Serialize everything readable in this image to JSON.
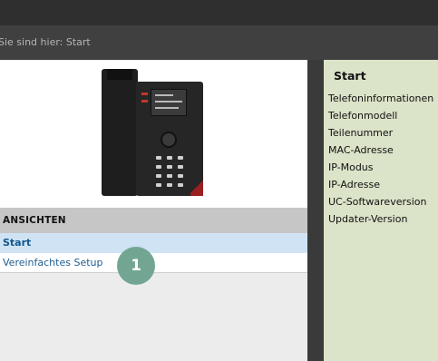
{
  "breadcrumb": {
    "text": "Sie sind hier: Start"
  },
  "views": {
    "header": "ANSICHTEN",
    "items": [
      {
        "label": "Start",
        "selected": true
      },
      {
        "label": "Vereinfachtes Setup",
        "selected": false
      }
    ]
  },
  "annotation": {
    "badge": "1"
  },
  "info_panel": {
    "title": "Start",
    "items": [
      "Telefoninformationen",
      "Telefonmodell",
      "Teilenummer",
      "MAC-Adresse",
      "IP-Modus",
      "IP-Adresse",
      "UC-Softwareversion",
      "Updater-Version"
    ]
  },
  "colors": {
    "selected_item_bg": "#cfe3f5",
    "link": "#1f5c8e",
    "info_panel_bg": "#dbe3c8",
    "badge": "#72a693"
  },
  "icons": [
    "desk-phone-image"
  ]
}
